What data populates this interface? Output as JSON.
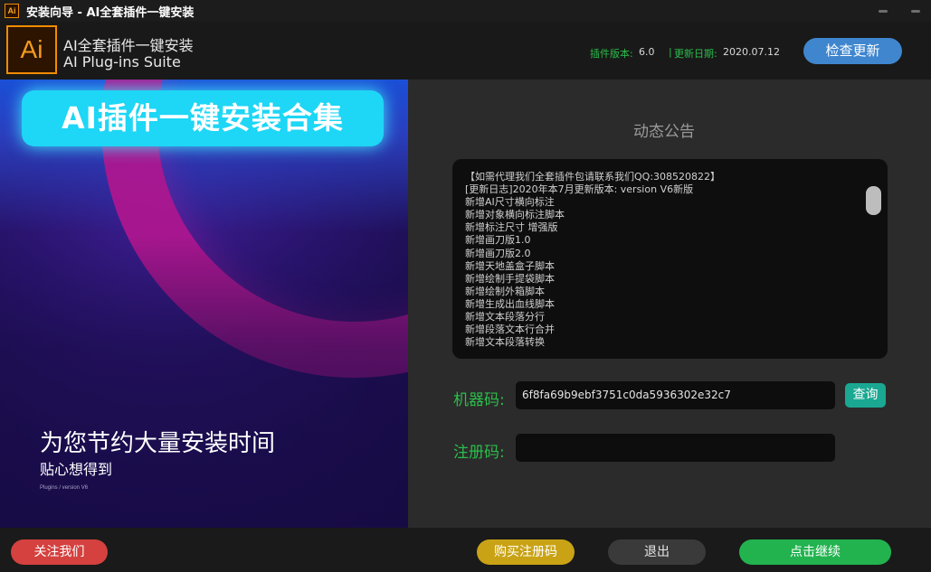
{
  "titlebar": {
    "icon_text": "Ai",
    "title": "安装向导 - AI全套插件一键安装"
  },
  "header": {
    "logo_text": "Ai",
    "title_cn": "AI全套插件一键安装",
    "title_en": "AI Plug-ins Suite",
    "version_label": "插件版本:",
    "version_value": "6.0",
    "separator": "|",
    "date_label": "更新日期:",
    "date_value": "2020.07.12",
    "update_button": "检查更新"
  },
  "banner": {
    "headline": "AI插件一键安装合集",
    "line1": "为您节约大量安装时间",
    "line2": "贴心想得到",
    "small": "Plugins / version V6"
  },
  "notice": {
    "title": "动态公告",
    "lines": [
      "【如需代理我们全套插件包请联系我们QQ:308520822】",
      "[更新日志]2020年本7月更新版本: version V6新版",
      "新增AI尺寸横向标注",
      "新增对象横向标注脚本",
      "新增标注尺寸 增强版",
      "新增画刀版1.0",
      "新增画刀版2.0",
      "新增天地盖盒子脚本",
      "新增绘制手提袋脚本",
      "新增绘制外箱脚本",
      "新增生成出血线脚本",
      "新增文本段落分行",
      "新增段落文本行合并",
      "新增文本段落转换"
    ]
  },
  "form": {
    "machine_label": "机器码:",
    "machine_code": "6f8fa69b9ebf3751c0da5936302e32c7",
    "query_button": "查询",
    "reg_label": "注册码:",
    "reg_value": ""
  },
  "footer": {
    "follow_button": "关注我们",
    "buy_button": "购买注册码",
    "exit_button": "退出",
    "continue_button": "点击继续"
  },
  "colors": {
    "accent_green": "#2bbd4a",
    "update_blue": "#3f86cf",
    "follow_red": "#d4413f",
    "buy_gold": "#c9a315",
    "continue_green": "#22b34f",
    "query_teal": "#1aa892",
    "logo_orange": "#f28c00"
  }
}
